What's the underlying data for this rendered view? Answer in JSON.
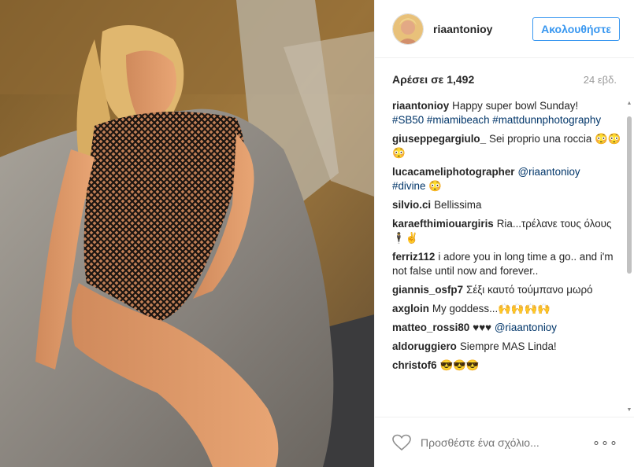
{
  "post": {
    "username": "riaantonioy",
    "follow_label": "Ακολουθήστε",
    "likes_label": "Αρέσει σε 1,492",
    "time_ago": "24 εβδ."
  },
  "comments": [
    {
      "user": "riaantonioy",
      "text": "Happy super bowl Sunday!",
      "tags": "#SB50 #miamibeach #mattdunnphotography"
    },
    {
      "user": "giuseppegargiulo_",
      "text": "Sei proprio una roccia 😳😳😳"
    },
    {
      "user": "lucacameliphotographer",
      "tag_inline": "@riaantonioy",
      "tags": "#divine 😳"
    },
    {
      "user": "silvio.ci",
      "text": "Bellissima"
    },
    {
      "user": "karaefthimiouargiris",
      "text": "Ria...τρέλανε τους όλους 🕴✌"
    },
    {
      "user": "ferriz112",
      "text": "i adore you in long time a go.. and i'm not false until now and forever.."
    },
    {
      "user": "giannis_osfp7",
      "text": "Σέξι καυτό τούμπανο μωρό"
    },
    {
      "user": "axgloin",
      "text": "My goddess...🙌🙌🙌🙌"
    },
    {
      "user": "matteo_rossi80",
      "text": "♥♥♥",
      "tag_inline": "@riaantonioy"
    },
    {
      "user": "aldoruggiero",
      "text": "Siempre MAS Linda!"
    },
    {
      "user": "christof6",
      "text": "😎😎😎"
    }
  ],
  "footer": {
    "comment_placeholder": "Προσθέστε ένα σχόλιο...",
    "more_label": "∘∘∘"
  },
  "colors": {
    "link": "#003569",
    "follow": "#3897f0"
  },
  "icons": [
    "heart-icon",
    "more-options-icon"
  ]
}
